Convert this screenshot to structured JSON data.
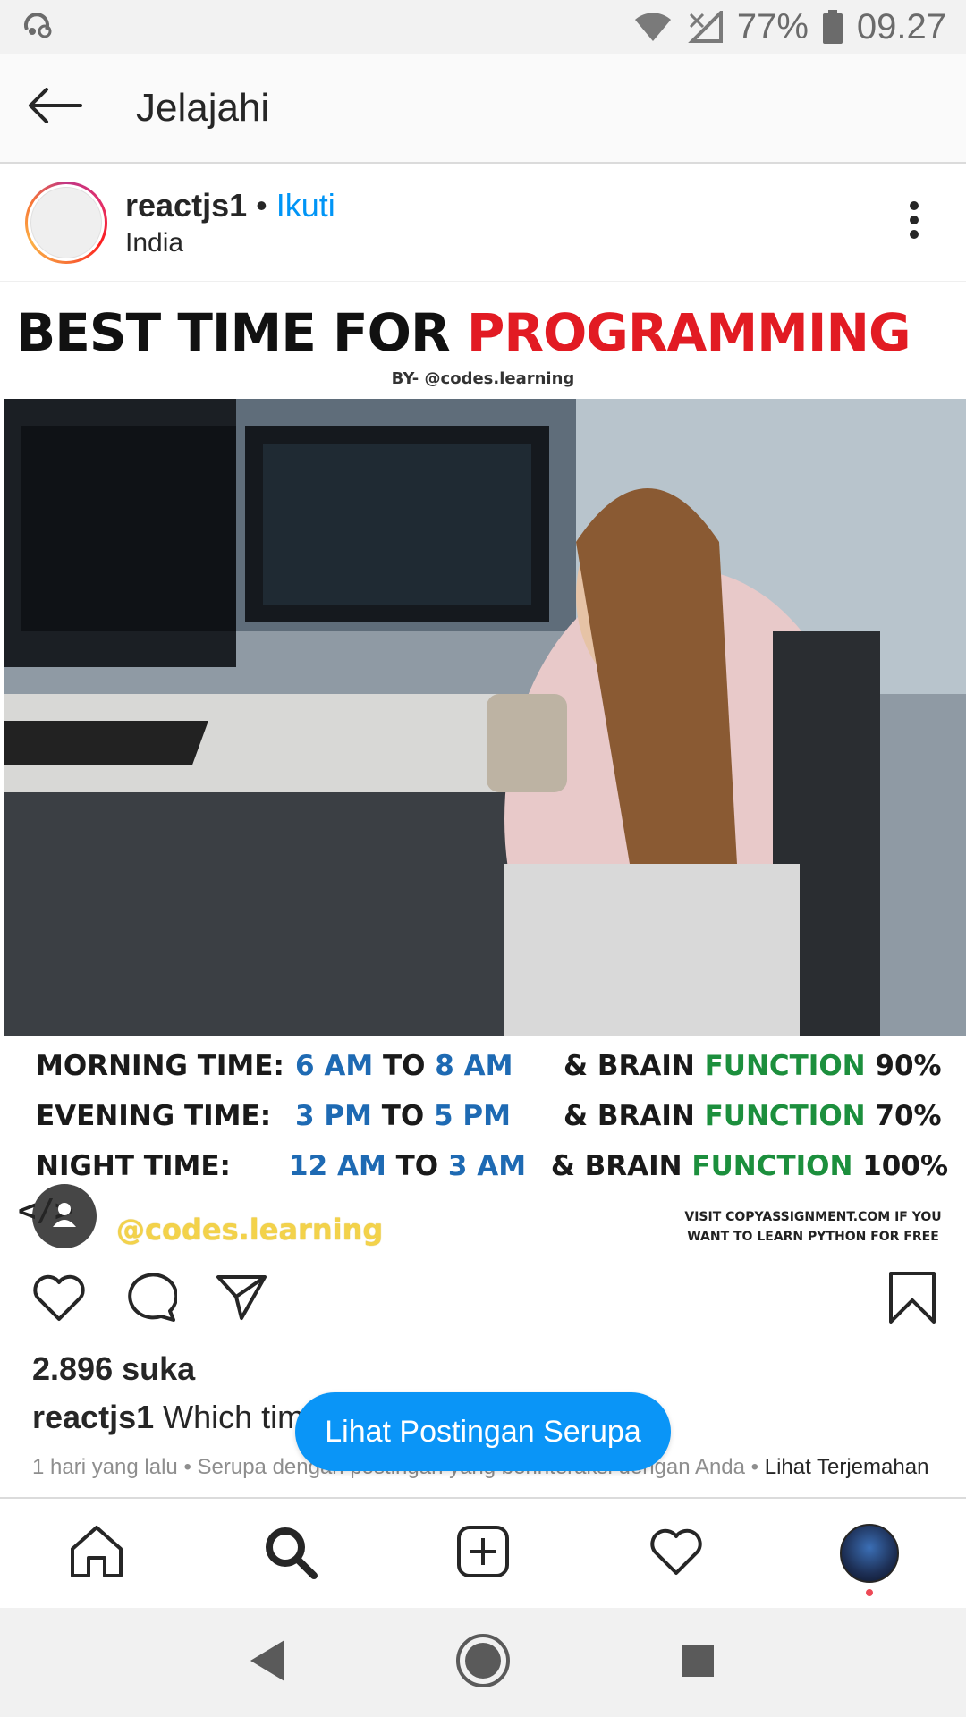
{
  "status_bar": {
    "battery_percent": "77%",
    "time": "09.27",
    "icons": [
      "app-notification-icon",
      "wifi-icon",
      "signal-icon",
      "battery-icon"
    ]
  },
  "header": {
    "title": "Jelajahi",
    "back_icon": "arrow-left-icon"
  },
  "post": {
    "username": "reactjs1",
    "separator": "•",
    "follow_label": "Ikuti",
    "location": "India",
    "image": {
      "headline_black": "BEST TIME FOR ",
      "headline_red": "PROGRAMMING",
      "byline": "BY- @codes.learning",
      "rows": [
        {
          "label": "MORNING TIME:",
          "from": "6 AM",
          "to_word": " TO ",
          "to": "8 AM",
          "brain": "& BRAIN ",
          "function_word": "FUNCTION",
          "percent": " 90%"
        },
        {
          "label": "EVENING TIME:",
          "from": "3 PM",
          "to_word": " TO ",
          "to": "5 PM",
          "brain": "& BRAIN ",
          "function_word": "FUNCTION",
          "percent": " 70%"
        },
        {
          "label": "NIGHT TIME:",
          "from": "12 AM",
          "to_word": " TO ",
          "to": "3 AM",
          "brain": "& BRAIN ",
          "function_word": "FUNCTION",
          "percent": " 100%"
        }
      ],
      "logo_glyph": "</>",
      "handle": "@codes.learning",
      "visit_text": "VISIT COPYASSIGNMENT.COM IF YOU WANT TO LEARN PYTHON FOR FREE"
    },
    "likes": "2.896 suka",
    "caption_user": "reactjs1",
    "caption_text": "Which time d",
    "meta_text": "1 hari yang lalu • Serupa dengan postingan yang berinteraksi dengan Anda • ",
    "translate_label": "Lihat Terjemahan",
    "similar_button": "Lihat Postingan Serupa"
  },
  "bottom_nav": {
    "items": [
      "home-icon",
      "search-icon",
      "add-post-icon",
      "activity-heart-icon",
      "profile-avatar"
    ]
  },
  "colors": {
    "accent_blue": "#0095f6",
    "pill_blue": "#0a95f7",
    "headline_red": "#e21b23",
    "time_blue": "#1e6ab3",
    "function_green": "#1c8f3d",
    "handle_yellow": "#f3d24a"
  }
}
